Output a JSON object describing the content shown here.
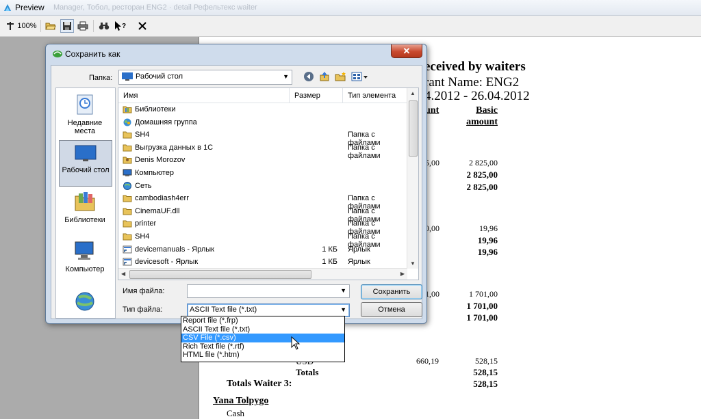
{
  "window": {
    "title": "Preview",
    "faded_caption": "Manager, Тобол, ресторан ENG2 · detail Рефельтекс waiter"
  },
  "toolbar": {
    "zoom_label": "100%"
  },
  "report": {
    "title": "eceived by waiters",
    "restaurant": "rant Name: ENG2",
    "period": "4.2012 - 26.04.2012",
    "col_amount": "unt",
    "col_basic_1": "Basic",
    "col_basic_2": "amount",
    "rows": [
      {
        "a": "5,00",
        "b": "2 825,00"
      },
      {
        "b": "2 825,00",
        "bold": true
      },
      {
        "b": "2 825,00",
        "bold": true
      },
      {
        "a": "0,00",
        "b": "19,96"
      },
      {
        "b": "19,96",
        "bold": true
      },
      {
        "b": "19,96",
        "bold": true
      },
      {
        "a": "1,00",
        "b": "1 701,00"
      },
      {
        "b": "1 701,00",
        "bold": true
      },
      {
        "b": "1 701,00",
        "bold": true
      }
    ],
    "usd_label": "USD",
    "usd_a": "660,19",
    "usd_b": "528,15",
    "totals_label": "Totals",
    "totals_value": "528,15",
    "totals_waiter": "Totals Waiter 3:",
    "totals_waiter_value": "528,15",
    "waiter_name": "Yana Tolpygo",
    "cash_label": "Cash"
  },
  "dialog": {
    "title": "Сохранить как",
    "close_glyph": "✕",
    "folder_label": "Папка:",
    "folder_value": "Рабочий стол",
    "places": [
      {
        "label_1": "Недавние",
        "label_2": "места"
      },
      {
        "label_1": "Рабочий стол",
        "label_2": ""
      },
      {
        "label_1": "Библиотеки",
        "label_2": ""
      },
      {
        "label_1": "Компьютер",
        "label_2": ""
      }
    ],
    "columns": {
      "name": "Имя",
      "size": "Размер",
      "type": "Тип элемента"
    },
    "files": [
      {
        "name": "Библиотеки",
        "size": "",
        "type": "",
        "icon": "library-folder-icon"
      },
      {
        "name": "Домашняя группа",
        "size": "",
        "type": "",
        "icon": "homegroup-icon"
      },
      {
        "name": "SH4",
        "size": "",
        "type": "Папка с файлами",
        "icon": "folder-icon"
      },
      {
        "name": "Выгрузка данных в 1С",
        "size": "",
        "type": "Папка с файлами",
        "icon": "folder-icon"
      },
      {
        "name": "Denis Morozov",
        "size": "",
        "type": "",
        "icon": "user-folder-icon"
      },
      {
        "name": "Компьютер",
        "size": "",
        "type": "",
        "icon": "computer-icon"
      },
      {
        "name": "Сеть",
        "size": "",
        "type": "",
        "icon": "network-icon"
      },
      {
        "name": "cambodiash4err",
        "size": "",
        "type": "Папка с файлами",
        "icon": "folder-icon"
      },
      {
        "name": "CinemaUF.dll",
        "size": "",
        "type": "Папка с файлами",
        "icon": "folder-icon"
      },
      {
        "name": "printer",
        "size": "",
        "type": "Папка с файлами",
        "icon": "folder-icon"
      },
      {
        "name": "SH4",
        "size": "",
        "type": "Папка с файлами",
        "icon": "folder-icon"
      },
      {
        "name": "devicemanuals - Ярлык",
        "size": "1 КБ",
        "type": "Ярлык",
        "icon": "shortcut-icon"
      },
      {
        "name": "devicesoft - Ярлык",
        "size": "1 КБ",
        "type": "Ярлык",
        "icon": "shortcut-icon"
      }
    ],
    "filename_label": "Имя файла:",
    "filename_value": "",
    "filetype_label": "Тип файла:",
    "filetype_value": "ASCII Text file (*.txt)",
    "save_button": "Сохранить",
    "cancel_button": "Отмена",
    "filetype_options": [
      "Report file (*.frp)",
      "ASCII Text file (*.txt)",
      "CSV File (*.csv)",
      "Rich Text file (*.rtf)",
      "HTML file (*.htm)"
    ],
    "highlighted_option": "CSV File (*.csv)"
  }
}
